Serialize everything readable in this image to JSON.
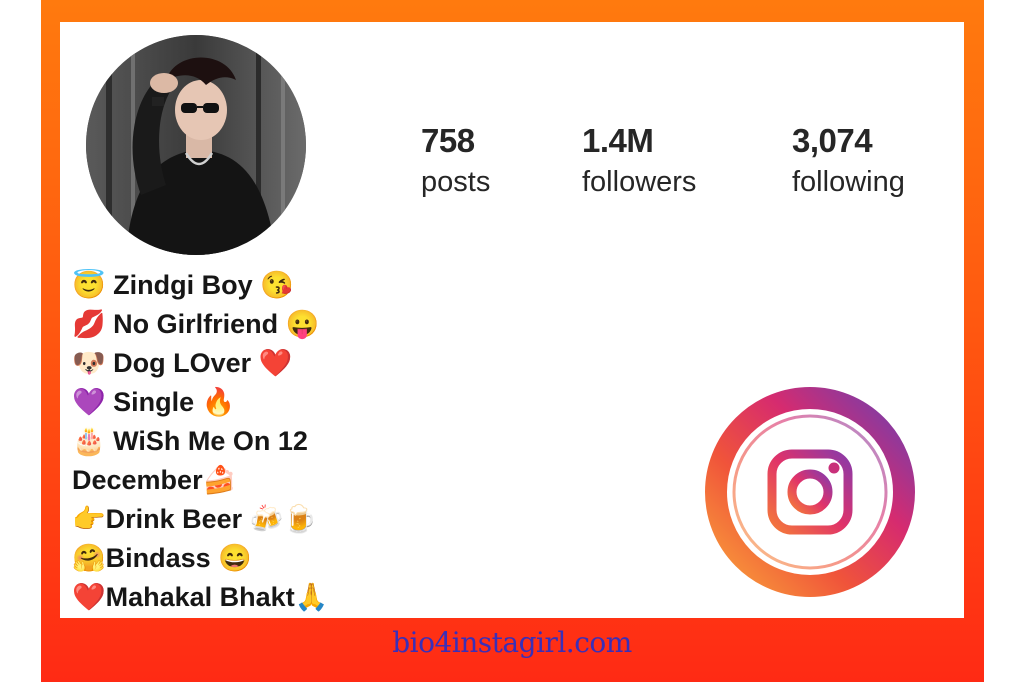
{
  "profile": {
    "stats": [
      {
        "value": "758",
        "label": "posts"
      },
      {
        "value": "1.4M",
        "label": "followers"
      },
      {
        "value": "3,074",
        "label": "following"
      }
    ],
    "bio": [
      "😇 Zindgi Boy 😘",
      "💋 No Girlfriend 😛",
      "🐶 Dog LOver ❤️",
      "💜 Single 🔥",
      "🎂 WiSh Me On 12",
      "December🍰",
      "👉Drink Beer 🍻🍺",
      "🤗Bindass 😄",
      "❤️Mahakal Bhakt🙏"
    ]
  },
  "footer": {
    "site": "bio4instagirl.com"
  },
  "colors": {
    "frame_top": "#ff7a0e",
    "frame_bottom": "#ff2a14",
    "site_text": "#3a2fb8"
  },
  "icons": [
    "instagram-logo",
    "profile-avatar"
  ]
}
